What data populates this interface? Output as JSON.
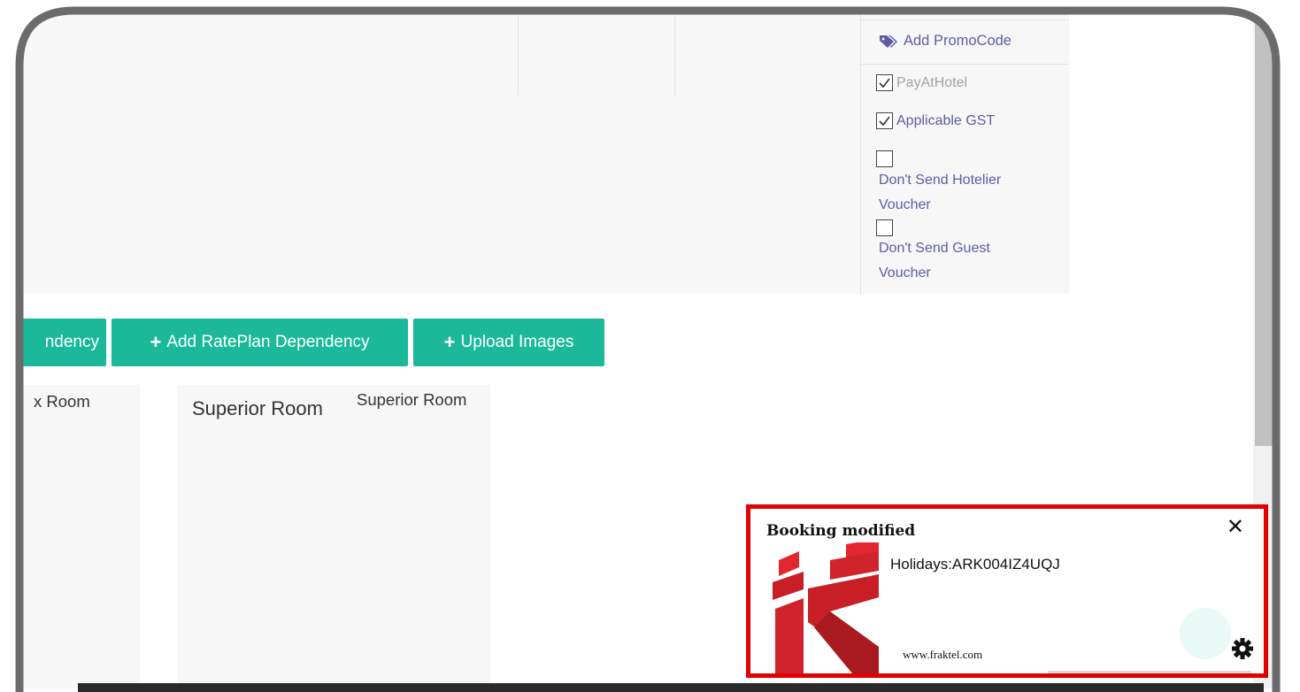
{
  "promo": {
    "label": "Add PromoCode"
  },
  "options": {
    "pay_at_hotel": {
      "label": "PayAtHotel",
      "checked": true
    },
    "applicable_gst": {
      "label": "Applicable GST",
      "checked": true
    },
    "dont_send_hotelier_voucher": {
      "label_line1": "Don't Send Hotelier",
      "label_line2": "Voucher",
      "checked": false
    },
    "dont_send_guest_voucher": {
      "label_line1": "Don't Send Guest",
      "label_line2": "Voucher",
      "checked": false
    }
  },
  "toolbar": {
    "dependency_partial": "ndency",
    "add_rateplan_dependency": "Add RatePlan Dependency",
    "upload_images": "Upload Images"
  },
  "rooms": {
    "partial_room": "x Room",
    "superior_room_title": "Superior Room",
    "superior_room_subtitle": "Superior Room"
  },
  "notification": {
    "title": "Booking modified",
    "message": "Holidays:ARK004IZ4UQJ",
    "site": "www.fraktel.com",
    "close": "✕"
  },
  "colors": {
    "accent": "#1bb99a",
    "link": "#5b5ea6",
    "alert_border": "#e00000"
  }
}
